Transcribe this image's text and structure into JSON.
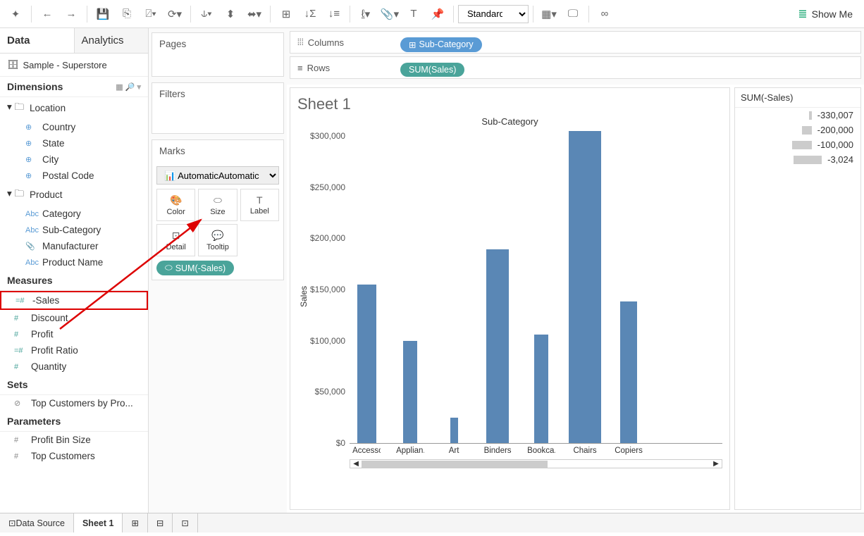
{
  "toolbar": {
    "fit": "Standard",
    "show_me": "Show Me"
  },
  "sidebar": {
    "tabs": {
      "data": "Data",
      "analytics": "Analytics"
    },
    "datasource": "Sample - Superstore",
    "dimensions_hdr": "Dimensions",
    "location_grp": "Location",
    "country": "Country",
    "state": "State",
    "city": "City",
    "postal": "Postal Code",
    "product_grp": "Product",
    "category": "Category",
    "subcategory": "Sub-Category",
    "manufacturer": "Manufacturer",
    "product_name": "Product Name",
    "measures_hdr": "Measures",
    "neg_sales": "-Sales",
    "discount": "Discount",
    "profit": "Profit",
    "profit_ratio": "Profit Ratio",
    "quantity": "Quantity",
    "sets_hdr": "Sets",
    "top_customers": "Top Customers by Pro...",
    "params_hdr": "Parameters",
    "profit_bin": "Profit Bin Size",
    "top_cust_param": "Top Customers"
  },
  "shelves": {
    "pages": "Pages",
    "filters": "Filters",
    "marks": "Marks",
    "mark_type": "Automatic",
    "color": "Color",
    "size": "Size",
    "label": "Label",
    "detail": "Detail",
    "tooltip": "Tooltip",
    "size_pill": "SUM(-Sales)",
    "columns": "Columns",
    "rows": "Rows",
    "col_pill": "Sub-Category",
    "row_pill": "SUM(Sales)"
  },
  "sheet": {
    "title": "Sheet 1",
    "chart_title": "Sub-Category",
    "y_label": "Sales"
  },
  "legend": {
    "title": "SUM(-Sales)",
    "items": [
      {
        "w": 4,
        "v": "-330,007"
      },
      {
        "w": 14,
        "v": "-200,000"
      },
      {
        "w": 28,
        "v": "-100,000"
      },
      {
        "w": 40,
        "v": "-3,024"
      }
    ]
  },
  "chart_data": {
    "type": "bar",
    "title": "Sub-Category",
    "xlabel": "Sub-Category",
    "ylabel": "Sales",
    "ylim": [
      0,
      320000
    ],
    "y_ticks": [
      "$300,000",
      "$250,000",
      "$200,000",
      "$150,000",
      "$100,000",
      "$50,000",
      "$0"
    ],
    "categories": [
      "Accesso..",
      "Applian..",
      "Art",
      "Binders",
      "Bookca..",
      "Chairs",
      "Copiers"
    ],
    "values": [
      168000,
      108000,
      27000,
      205000,
      115000,
      330000,
      150000
    ]
  },
  "bottom": {
    "data_source": "Data Source",
    "sheet1": "Sheet 1"
  }
}
